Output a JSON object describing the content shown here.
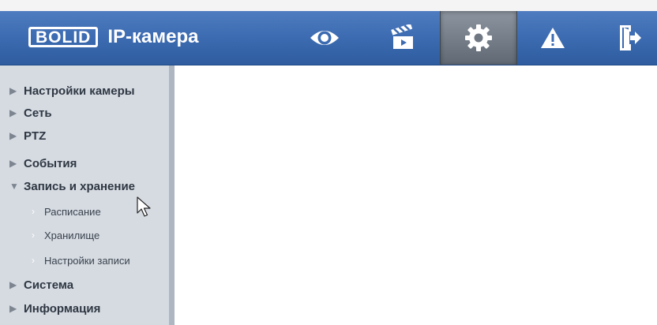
{
  "header": {
    "logo_text": "BOLID",
    "title": "IP-камера",
    "buttons": [
      {
        "icon": "eye-icon",
        "active": false
      },
      {
        "icon": "clapperboard-icon",
        "active": false
      },
      {
        "icon": "gear-icon",
        "active": true
      },
      {
        "icon": "warning-icon",
        "active": false
      },
      {
        "icon": "logout-icon",
        "active": false
      }
    ]
  },
  "sidebar": {
    "items": [
      {
        "label": "Настройки камеры",
        "expanded": false
      },
      {
        "label": "Сеть",
        "expanded": false
      },
      {
        "label": "PTZ",
        "expanded": false
      },
      {
        "label": "События",
        "expanded": false
      },
      {
        "label": "Запись и хранение",
        "expanded": true,
        "children": [
          {
            "label": "Расписание"
          },
          {
            "label": "Хранилище"
          },
          {
            "label": "Настройки записи"
          }
        ]
      },
      {
        "label": "Система",
        "expanded": false
      },
      {
        "label": "Информация",
        "expanded": false
      }
    ]
  },
  "colors": {
    "header": "#3c6bb1",
    "sidebar": "#d6dbe2",
    "active_tab": "#6f7782"
  }
}
